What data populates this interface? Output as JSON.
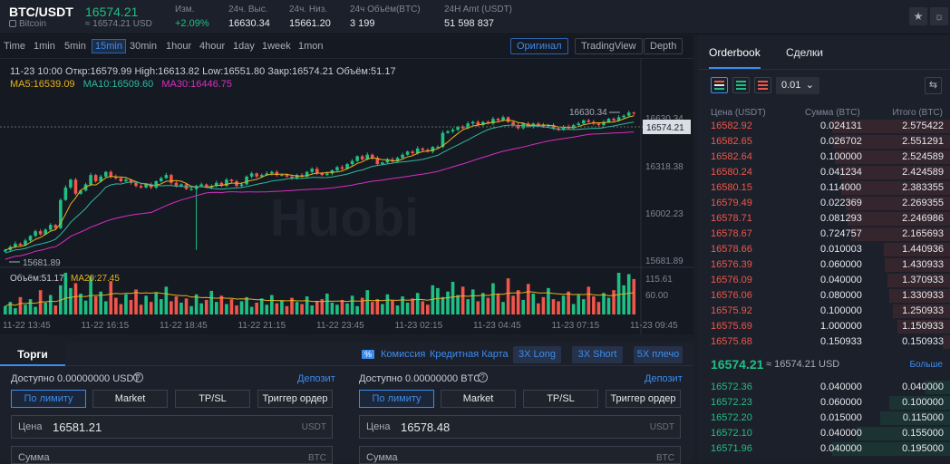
{
  "header": {
    "pair": "BTC/USDT",
    "pair_sub": "Bitcoin",
    "last_price": "16574.21",
    "last_sub": "≈ 16574.21 USD",
    "stats": [
      {
        "label": "Изм.",
        "value": "+2.09%",
        "color": "#1fbf84"
      },
      {
        "label": "24ч. Выс.",
        "value": "16630.34",
        "color": "#e6e8ec"
      },
      {
        "label": "24ч. Низ.",
        "value": "15661.20",
        "color": "#e6e8ec"
      },
      {
        "label": "24ч Объём(BTC)",
        "value": "3 199",
        "color": "#e6e8ec"
      },
      {
        "label": "24H Amt (USDT)",
        "value": "51 598 837",
        "color": "#e6e8ec"
      }
    ],
    "icons": [
      "star-icon",
      "theme-icon"
    ]
  },
  "chart": {
    "timeframes": [
      "Time",
      "1min",
      "5min",
      "15min",
      "30min",
      "1hour",
      "4hour",
      "1day",
      "1week",
      "1mon"
    ],
    "active_timeframe": "15min",
    "views": [
      "Оригинал",
      "TradingView",
      "Depth"
    ],
    "active_view": "Оригинал",
    "ohlc": "11-23 10:00   Откр:16579.99  High:16613.82  Low:16551.80  Закр:16574.21  Объём:51.17",
    "ma5": "MA5:16539.09",
    "ma10": "MA10:16509.60",
    "ma30": "MA30:16446.75",
    "price_high_label": "16630.34",
    "price_low_label": "15681.89",
    "current_price_tag": "16574.21",
    "y_ticks": [
      "16630.34",
      "16318.38",
      "16002.23",
      "15681.89"
    ],
    "volume_label": "Объём:51.17",
    "vol_ma": "MA20:27.45",
    "vol_ticks": [
      "115.61",
      "60.00"
    ],
    "x_ticks": [
      "11-22 13:45",
      "11-22 16:15",
      "11-22 18:45",
      "11-22 21:15",
      "11-22 23:45",
      "11-23 02:15",
      "11-23 04:45",
      "11-23 07:15",
      "11-23 09:45"
    ],
    "watermark": "Huobi",
    "colors": {
      "up": "#1fbf84",
      "down": "#f0564a",
      "ma5": "#e6b31e",
      "ma10": "#2fb8a0",
      "ma30": "#d62fc2"
    }
  },
  "chart_data": {
    "type": "candlestick",
    "price_range": [
      15600,
      16680
    ],
    "closes": [
      15700,
      15720,
      15740,
      15730,
      15760,
      15790,
      15820,
      15800,
      15830,
      15860,
      15840,
      16020,
      16100,
      16150,
      16060,
      16080,
      16120,
      16180,
      16140,
      16170,
      16200,
      16170,
      16160,
      16140,
      16150,
      16130,
      16110,
      16100,
      16120,
      16100,
      16140,
      16160,
      16180,
      16130,
      16110,
      16120,
      16090,
      16090,
      16110,
      16120,
      16100,
      16110,
      16130,
      16110,
      16150,
      16140,
      16110,
      16120,
      16170,
      16190,
      16170,
      16180,
      16190,
      16200,
      16180,
      16180,
      16170,
      16160,
      16180,
      16170,
      16200,
      16220,
      16190,
      16180,
      16190,
      16210,
      16230,
      16220,
      16250,
      16270,
      16300,
      16280,
      16310,
      16290,
      16250,
      16260,
      16280,
      16270,
      16290,
      16310,
      16330,
      16320,
      16350,
      16340,
      16330,
      16360,
      16360,
      16450,
      16460,
      16470,
      16490,
      16480,
      16510,
      16520,
      16500,
      16520,
      16510,
      16540,
      16530,
      16550,
      16520,
      16500,
      16480,
      16510,
      16490,
      16510,
      16500,
      16490,
      16500,
      16480,
      16470,
      16490,
      16480,
      16500,
      16510,
      16530,
      16520,
      16510,
      16500,
      16520,
      16540,
      16530,
      16550,
      16560,
      16580,
      16574
    ],
    "volumes": [
      12,
      18,
      9,
      25,
      14,
      22,
      11,
      35,
      17,
      28,
      13,
      42,
      60,
      38,
      45,
      30,
      20,
      55,
      26,
      33,
      19,
      48,
      24,
      15,
      29,
      21,
      36,
      14,
      27,
      18,
      31,
      22,
      40,
      19,
      26,
      17,
      23,
      12,
      29,
      16,
      21,
      34,
      18,
      27,
      15,
      22,
      13,
      19,
      25,
      11,
      17,
      23,
      14,
      28,
      16,
      20,
      12,
      24,
      18,
      15,
      26,
      13,
      19,
      22,
      30,
      17,
      14,
      21,
      16,
      27,
      12,
      24,
      35,
      18,
      22,
      15,
      29,
      20,
      13,
      26,
      17,
      23,
      31,
      19,
      14,
      42,
      38,
      25,
      33,
      47,
      28,
      40,
      22,
      36,
      19,
      31,
      24,
      45,
      29,
      18,
      52,
      27,
      35,
      21,
      44,
      30,
      16,
      25,
      38,
      22,
      19,
      27,
      33,
      15,
      28,
      22,
      40,
      26,
      18,
      31,
      24,
      35,
      60,
      42,
      58,
      51
    ]
  },
  "trade": {
    "tab": "Торги",
    "commission": "Комиссия",
    "commission_badge": "%",
    "credit": "Кредитная Карта",
    "promo": [
      "3X Long",
      "3X Short",
      "5X плечо"
    ],
    "buy": {
      "avail": "Доступно  0.00000000 USDT",
      "deposit": "Депозит",
      "price": "16581.21",
      "price_label": "Цена",
      "price_unit": "USDT",
      "amount_label": "Сумма",
      "amount_unit": "BTC"
    },
    "sell": {
      "avail": "Доступно  0.00000000 BTC",
      "deposit": "Депозит",
      "price": "16578.48",
      "price_label": "Цена",
      "price_unit": "USDT",
      "amount_label": "Сумма",
      "amount_unit": "BTC"
    },
    "order_tabs": [
      "По лимиту",
      "Market",
      "TP/SL",
      "Триггер ордер"
    ]
  },
  "orderbook": {
    "tabs": [
      "Orderbook",
      "Сделки"
    ],
    "precision": "0.01",
    "headers": [
      "Цена (USDT)",
      "Сумма (BTC)",
      "Итого (BTC)"
    ],
    "asks": [
      [
        "16582.92",
        "0.024131",
        "2.575422"
      ],
      [
        "16582.65",
        "0.026702",
        "2.551291"
      ],
      [
        "16582.64",
        "0.100000",
        "2.524589"
      ],
      [
        "16580.24",
        "0.041234",
        "2.424589"
      ],
      [
        "16580.15",
        "0.114000",
        "2.383355"
      ],
      [
        "16579.49",
        "0.022369",
        "2.269355"
      ],
      [
        "16578.71",
        "0.081293",
        "2.246986"
      ],
      [
        "16578.67",
        "0.724757",
        "2.165693"
      ],
      [
        "16578.66",
        "0.010003",
        "1.440936"
      ],
      [
        "16576.39",
        "0.060000",
        "1.430933"
      ],
      [
        "16576.09",
        "0.040000",
        "1.370933"
      ],
      [
        "16576.06",
        "0.080000",
        "1.330933"
      ],
      [
        "16575.92",
        "0.100000",
        "1.250933"
      ],
      [
        "16575.69",
        "1.000000",
        "1.150933"
      ],
      [
        "16575.68",
        "0.150933",
        "0.150933"
      ]
    ],
    "mid_price": "16574.21",
    "mid_usd": "≈ 16574.21 USD",
    "more": "Больше",
    "bids": [
      [
        "16572.36",
        "0.040000",
        "0.040000"
      ],
      [
        "16572.23",
        "0.060000",
        "0.100000"
      ],
      [
        "16572.20",
        "0.015000",
        "0.115000"
      ],
      [
        "16572.10",
        "0.040000",
        "0.155000"
      ],
      [
        "16571.96",
        "0.040000",
        "0.195000"
      ]
    ]
  }
}
